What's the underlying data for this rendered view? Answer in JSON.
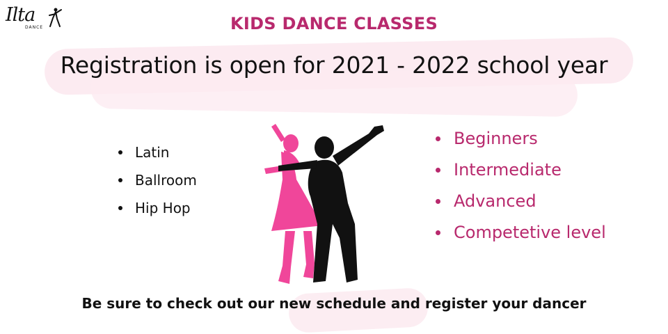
{
  "logo": {
    "wordmark": "Ilta",
    "subtext": "DANCE"
  },
  "header": {
    "kicker": "KIDS DANCE CLASSES",
    "headline": "Registration is open for 2021 - 2022 school year"
  },
  "styles": {
    "items": [
      "Latin",
      "Ballroom",
      "Hip Hop"
    ]
  },
  "levels": {
    "items": [
      "Beginners",
      "Intermediate",
      "Advanced",
      "Competetive level"
    ]
  },
  "footer": {
    "cta": "Be sure to check out our new schedule and register your dancer"
  },
  "colors": {
    "accent": "#b8296d",
    "pink_dancer": "#f0469a",
    "text": "#111111",
    "brush": "#fcebf1"
  }
}
